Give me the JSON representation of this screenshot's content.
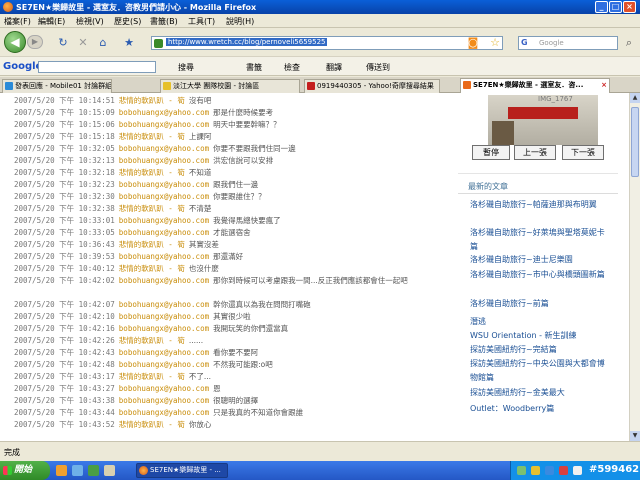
{
  "window": {
    "title": "SE7EN★樂歸故里 - 選室友．咨教男們請小心 - Mozilla Firefox"
  },
  "menubar": {
    "items": [
      "檔案(F)",
      "編輯(E)",
      "檢視(V)",
      "歷史(S)",
      "書籤(B)",
      "工具(T)",
      "說明(H)"
    ]
  },
  "nav": {
    "url": "http://www.wretch.cc/blog/pernoveli5659525",
    "search_placeholder": "Google"
  },
  "gtoolbar": {
    "logo": "Google",
    "search_label": "搜尋",
    "bookmarks_label": "書籤",
    "check_label": "檢查",
    "translate_label": "翻譯",
    "send_label": "傳送到"
  },
  "tabs": [
    {
      "label": "發表回應 - Mobile01 討論群組",
      "active": false
    },
    {
      "label": "淡江大學 團隊校園 - 討論區",
      "active": false
    },
    {
      "label": "0919440305 - Yahoo!奇摩搜尋結果",
      "active": false
    },
    {
      "label": "SE7EN★樂歸故里 - 選室友．咨...",
      "active": true
    }
  ],
  "chat": [
    {
      "ts": "2007/5/20 下午 10:14:51",
      "user": "悲情的軟趴趴 - 筍",
      "msg": "沒有吧",
      "userStyle": "name"
    },
    {
      "ts": "2007/5/20 下午 10:15:09",
      "user": "bobohuangx@yahoo.com",
      "msg": "那是什麼時候要考",
      "userStyle": "email"
    },
    {
      "ts": "2007/5/20 下午 10:15:06",
      "user": "bobohuangx@yahoo.com",
      "msg": "明天中要要幹嘛？？",
      "userStyle": "email"
    },
    {
      "ts": "2007/5/20 下午 10:15:18",
      "user": "悲情的軟趴趴 - 筍",
      "msg": "上課阿",
      "userStyle": "name"
    },
    {
      "ts": "2007/5/20 下午 10:32:05",
      "user": "bobohuangx@yahoo.com",
      "msg": "你要不要跟我們住同一邊",
      "userStyle": "email"
    },
    {
      "ts": "2007/5/20 下午 10:32:13",
      "user": "bobohuangx@yahoo.com",
      "msg": "洪宏信說可以安排",
      "userStyle": "email"
    },
    {
      "ts": "2007/5/20 下午 10:32:18",
      "user": "悲情的軟趴趴 - 筍",
      "msg": "不知道",
      "userStyle": "name"
    },
    {
      "ts": "2007/5/20 下午 10:32:23",
      "user": "bobohuangx@yahoo.com",
      "msg": "跟我們住一邊",
      "userStyle": "email"
    },
    {
      "ts": "2007/5/20 下午 10:32:30",
      "user": "bobohuangx@yahoo.com",
      "msg": "你要跟誰住？？",
      "userStyle": "email"
    },
    {
      "ts": "2007/5/20 下午 10:32:38",
      "user": "悲情的軟趴趴 - 筍",
      "msg": "不清楚",
      "userStyle": "name"
    },
    {
      "ts": "2007/5/20 下午 10:33:01",
      "user": "bobohuangx@yahoo.com",
      "msg": "我覺得馬總快要瘋了",
      "userStyle": "email"
    },
    {
      "ts": "2007/5/20 下午 10:33:05",
      "user": "bobohuangx@yahoo.com",
      "msg": "才能選宿舍",
      "userStyle": "email"
    },
    {
      "ts": "2007/5/20 下午 10:36:43",
      "user": "悲情的軟趴趴 - 筍",
      "msg": "其實沒差",
      "userStyle": "name"
    },
    {
      "ts": "2007/5/20 下午 10:39:53",
      "user": "bobohuangx@yahoo.com",
      "msg": "那還滿好",
      "userStyle": "email"
    },
    {
      "ts": "2007/5/20 下午 10:40:12",
      "user": "悲情的軟趴趴 - 筍",
      "msg": "也沒什麼",
      "userStyle": "name"
    },
    {
      "ts": "2007/5/20 下午 10:42:02",
      "user": "bobohuangx@yahoo.com",
      "msg": "那你到時候可以考慮跟我一間...反正我們應該都會住一起吧",
      "userStyle": "email",
      "wrap": true
    },
    {
      "ts": "2007/5/20 下午 10:42:07",
      "user": "bobohuangx@yahoo.com",
      "msg": "幹你還真以為我在問問打嘴砲",
      "userStyle": "email"
    },
    {
      "ts": "2007/5/20 下午 10:42:10",
      "user": "bobohuangx@yahoo.com",
      "msg": "其實很少啦",
      "userStyle": "email"
    },
    {
      "ts": "2007/5/20 下午 10:42:16",
      "user": "bobohuangx@yahoo.com",
      "msg": "我開玩笑的你們還當真",
      "userStyle": "email"
    },
    {
      "ts": "2007/5/20 下午 10:42:26",
      "user": "悲情的軟趴趴 - 筍",
      "msg": "......",
      "userStyle": "name"
    },
    {
      "ts": "2007/5/20 下午 10:42:43",
      "user": "bobohuangx@yahoo.com",
      "msg": "看你要不要阿",
      "userStyle": "email"
    },
    {
      "ts": "2007/5/20 下午 10:42:48",
      "user": "bobohuangx@yahoo.com",
      "msg": "不然我可能跟:o吧",
      "userStyle": "email"
    },
    {
      "ts": "2007/5/20 下午 10:43:17",
      "user": "悲情的軟趴趴 - 筍",
      "msg": "不了...",
      "userStyle": "name"
    },
    {
      "ts": "2007/5/20 下午 10:43:27",
      "user": "bobohuangx@yahoo.com",
      "msg": "恩",
      "userStyle": "email"
    },
    {
      "ts": "2007/5/20 下午 10:43:38",
      "user": "bobohuangx@yahoo.com",
      "msg": "很聰明的選擇",
      "userStyle": "email"
    },
    {
      "ts": "2007/5/20 下午 10:43:44",
      "user": "bobohuangx@yahoo.com",
      "msg": "只是我真的不知道你會跟誰",
      "userStyle": "email"
    },
    {
      "ts": "2007/5/20 下午 10:43:52",
      "user": "悲情的軟趴趴 - 筍",
      "msg": "你放心",
      "userStyle": "name"
    }
  ],
  "sidebar": {
    "photo_label": "IMG_1767",
    "buttons": {
      "pause": "暫停",
      "prev": "上一張",
      "next": "下一張"
    },
    "heading": "最新的文章",
    "articles": [
      "洛杉磯自助旅行~帕薩迪那與布明翼",
      "洛杉磯自助旅行~好萊塢與聖塔莫妮卡篇",
      "洛杉磯自助旅行~迪士尼樂園",
      "洛杉磯自助旅行~市中心與橋頭圖新篇",
      "洛杉磯自助旅行~前篇",
      "潛逃",
      "WSU Orientation - 新生訓練",
      "探訪美國紐約行~完結篇",
      "探訪美國紐約行~中央公園與大都會博物館篇",
      "探訪美國紐約行~金美最大",
      "Outlet：Woodberry篇"
    ]
  },
  "status": {
    "text": "完成"
  },
  "taskbar": {
    "start_label": "開始",
    "task_label": "SE7EN★樂歸故里 - ...",
    "clock": "#599462"
  }
}
